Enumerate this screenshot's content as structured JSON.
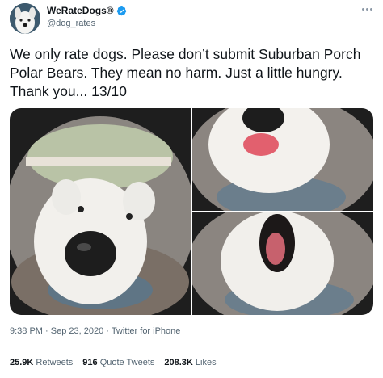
{
  "tweet": {
    "display_name": "WeRateDogs®",
    "handle": "@dog_rates",
    "text": "We only rate dogs. Please don’t submit Suburban Porch\nPolar Bears. They mean no harm. Just a little hungry.\nThank you... 13/10",
    "time": "9:38 PM",
    "date": "Sep 23, 2020",
    "separator": "·",
    "source": "Twitter for iPhone"
  },
  "stats": {
    "retweets_count": "25.9K",
    "retweets_label": "Retweets",
    "quotes_count": "916",
    "quotes_label": "Quote Tweets",
    "likes_count": "208.3K",
    "likes_label": "Likes"
  },
  "icons": {
    "verified": "verified-badge-icon",
    "more": "more-options-icon"
  },
  "colors": {
    "verified_blue": "#1d9bf0",
    "text_primary": "#0f1419",
    "text_secondary": "#536471"
  }
}
